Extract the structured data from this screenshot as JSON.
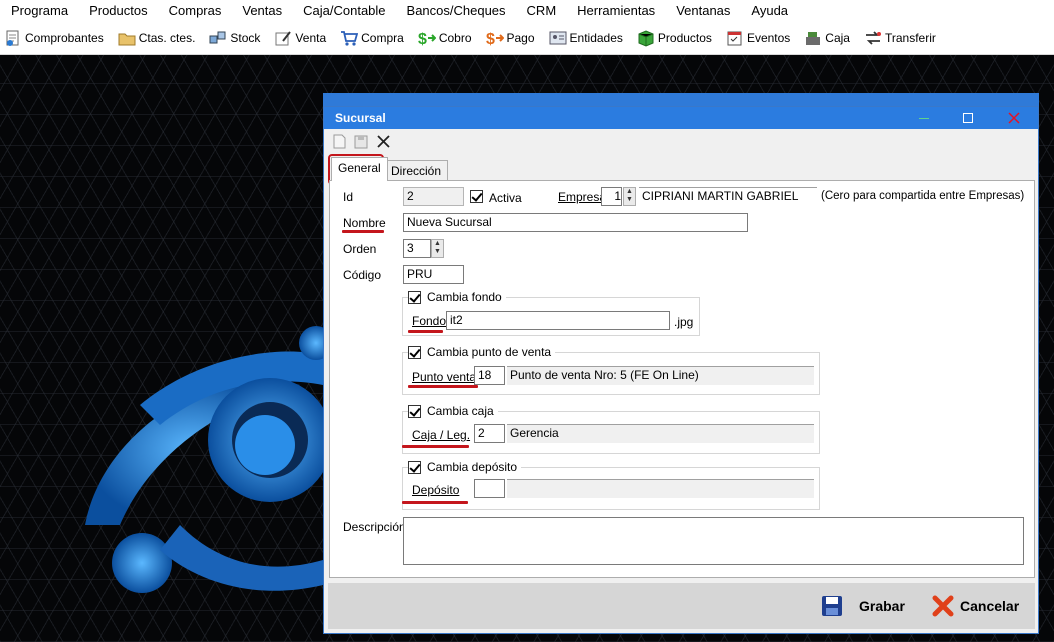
{
  "menu": [
    "Programa",
    "Productos",
    "Compras",
    "Ventas",
    "Caja/Contable",
    "Bancos/Cheques",
    "CRM",
    "Herramientas",
    "Ventanas",
    "Ayuda"
  ],
  "toolbar": [
    {
      "label": "Comprobantes",
      "icon": "documents-icon"
    },
    {
      "label": "Ctas. ctes.",
      "icon": "folder-icon"
    },
    {
      "label": "Stock",
      "icon": "boxes-icon"
    },
    {
      "label": "Venta",
      "icon": "pen-paper-icon"
    },
    {
      "label": "Compra",
      "icon": "cart-icon"
    },
    {
      "label": "Cobro",
      "icon": "money-in-icon"
    },
    {
      "label": "Pago",
      "icon": "money-out-icon"
    },
    {
      "label": "Entidades",
      "icon": "address-card-icon"
    },
    {
      "label": "Productos",
      "icon": "product-box-icon"
    },
    {
      "label": "Eventos",
      "icon": "calendar-icon"
    },
    {
      "label": "Caja",
      "icon": "cash-register-icon"
    },
    {
      "label": "Transferir",
      "icon": "transfer-icon"
    }
  ],
  "window": {
    "title": "Sucursal"
  },
  "tabs": {
    "general": "General",
    "direccion": "Dirección"
  },
  "form": {
    "id_label": "Id",
    "id_value": "2",
    "activa_label": "Activa",
    "empresa_label": "Empresa",
    "empresa_value": "1",
    "empresa_name": "CIPRIANI MARTIN GABRIEL",
    "empresa_hint": "(Cero para compartida entre Empresas)",
    "nombre_label": "Nombre",
    "nombre_value": "Nueva Sucursal",
    "orden_label": "Orden",
    "orden_value": "3",
    "codigo_label": "Código",
    "codigo_value": "PRU",
    "fondo": {
      "check_label": "Cambia fondo",
      "label": "Fondo",
      "value": "it2",
      "ext": ".jpg"
    },
    "punto": {
      "check_label": "Cambia punto de venta",
      "label": "Punto venta",
      "value": "18",
      "desc": "Punto de venta Nro: 5 (FE On Line)"
    },
    "caja": {
      "check_label": "Cambia caja",
      "label": "Caja / Leg.",
      "value": "2",
      "desc": "Gerencia"
    },
    "deposito": {
      "check_label": "Cambia depósito",
      "label": "Depósito",
      "value": "",
      "desc": ""
    },
    "descripcion_label": "Descripción",
    "descripcion_value": ""
  },
  "buttons": {
    "grabar": "Grabar",
    "cancelar": "Cancelar"
  },
  "colors": {
    "accent": "#2b7ce0",
    "annotation": "#c4161c"
  }
}
